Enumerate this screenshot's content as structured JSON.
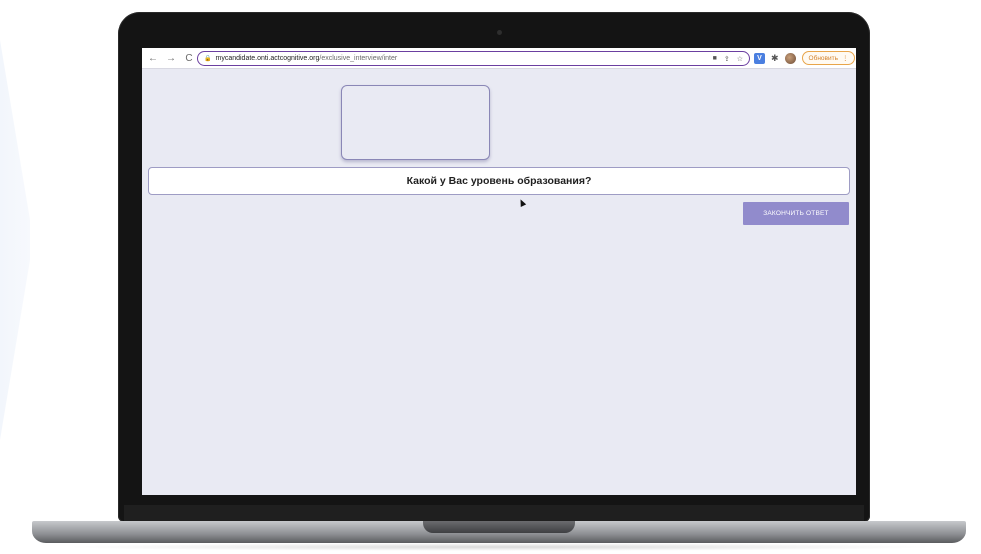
{
  "browser": {
    "back_icon": "←",
    "forward_icon": "→",
    "reload_icon": "C",
    "url_host": "mycandidate.onti.actcognitive.org",
    "url_path": "/exclusive_interview/inter",
    "lock_icon": "🔒",
    "video_icon": "■",
    "share_icon": "⇪",
    "star_icon": "☆",
    "extension_label": "V",
    "puzzle_icon": "✱",
    "update_label": "Обновить",
    "menu_icon": "⋮"
  },
  "page": {
    "question_text": "Какой у Вас уровень образования?",
    "finish_button_label": "ЗАКОНЧИТЬ ОТВЕТ"
  },
  "colors": {
    "page_background": "#e9eaf3",
    "accent_button": "#918bcc",
    "address_border": "#6b3fa0",
    "update_button": "#d4822a"
  }
}
